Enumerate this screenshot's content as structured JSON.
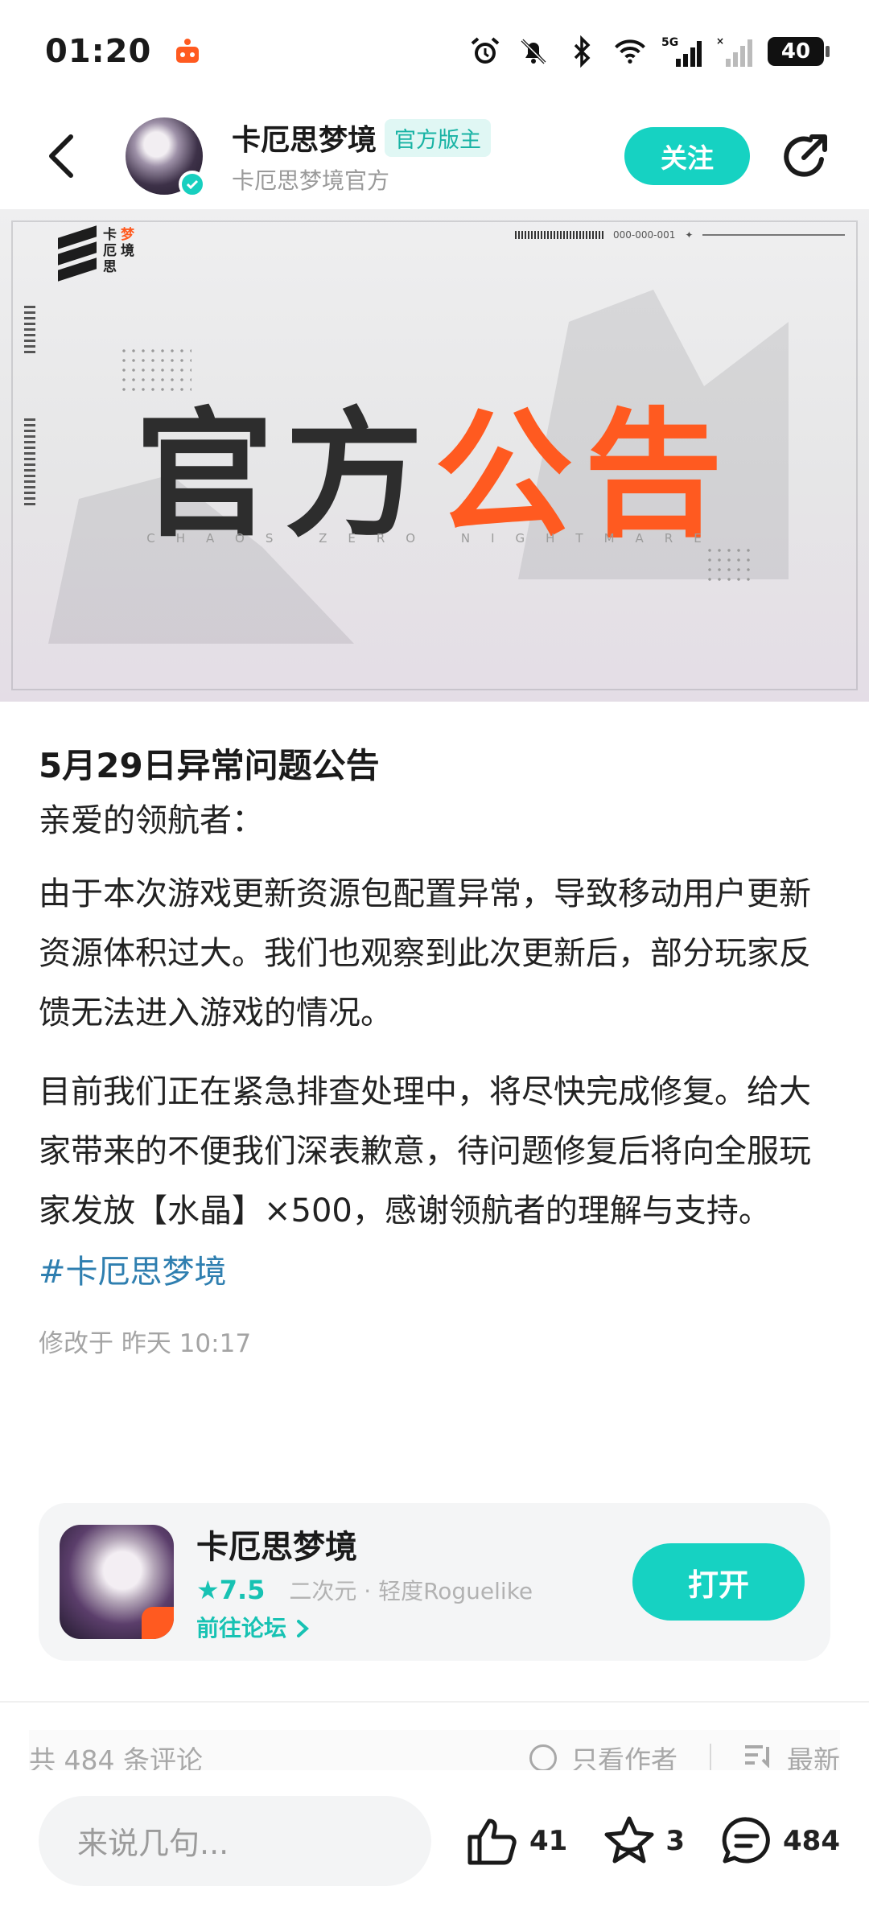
{
  "status_bar": {
    "time": "01:20",
    "network": "5G",
    "battery": "40"
  },
  "header": {
    "title": "卡厄思梦境",
    "badge": "官方版主",
    "subtitle": "卡厄思梦境官方",
    "follow_label": "关注"
  },
  "banner": {
    "title_dark": "官方",
    "title_orange": "公告",
    "caption": "CHAOS ZERO NIGHTMARE",
    "logo_text": [
      "卡",
      "梦",
      "厄",
      "境",
      "思"
    ],
    "code": "000-000-001"
  },
  "article": {
    "title": "5月29日异常问题公告",
    "greeting": "亲爱的领航者：",
    "paragraphs": [
      "由于本次游戏更新资源包配置异常，导致移动用户更新资源体积过大。我们也观察到此次更新后，部分玩家反馈无法进入游戏的情况。",
      "目前我们正在紧急排查处理中，将尽快完成修复。给大家带来的不便我们深表歉意，待问题修复后将向全服玩家发放【水晶】×500，感谢领航者的理解与支持。"
    ],
    "tag": "#卡厄思梦境",
    "modified": "修改于 昨天 10:17"
  },
  "game_card": {
    "name": "卡厄思梦境",
    "rating": "★7.5",
    "genre": "二次元 · 轻度Roguelike",
    "forum_link": "前往论坛",
    "open_label": "打开"
  },
  "comments": {
    "count_label": "共 484 条评论",
    "author_only": "只看作者",
    "sort": "最新"
  },
  "bottom_bar": {
    "input_placeholder": "来说几句...",
    "likes": "41",
    "favorites": "3",
    "comments": "484"
  },
  "colors": {
    "accent": "#16d2c2",
    "banner_orange": "#ff5a20",
    "link": "#2f7fb0"
  }
}
